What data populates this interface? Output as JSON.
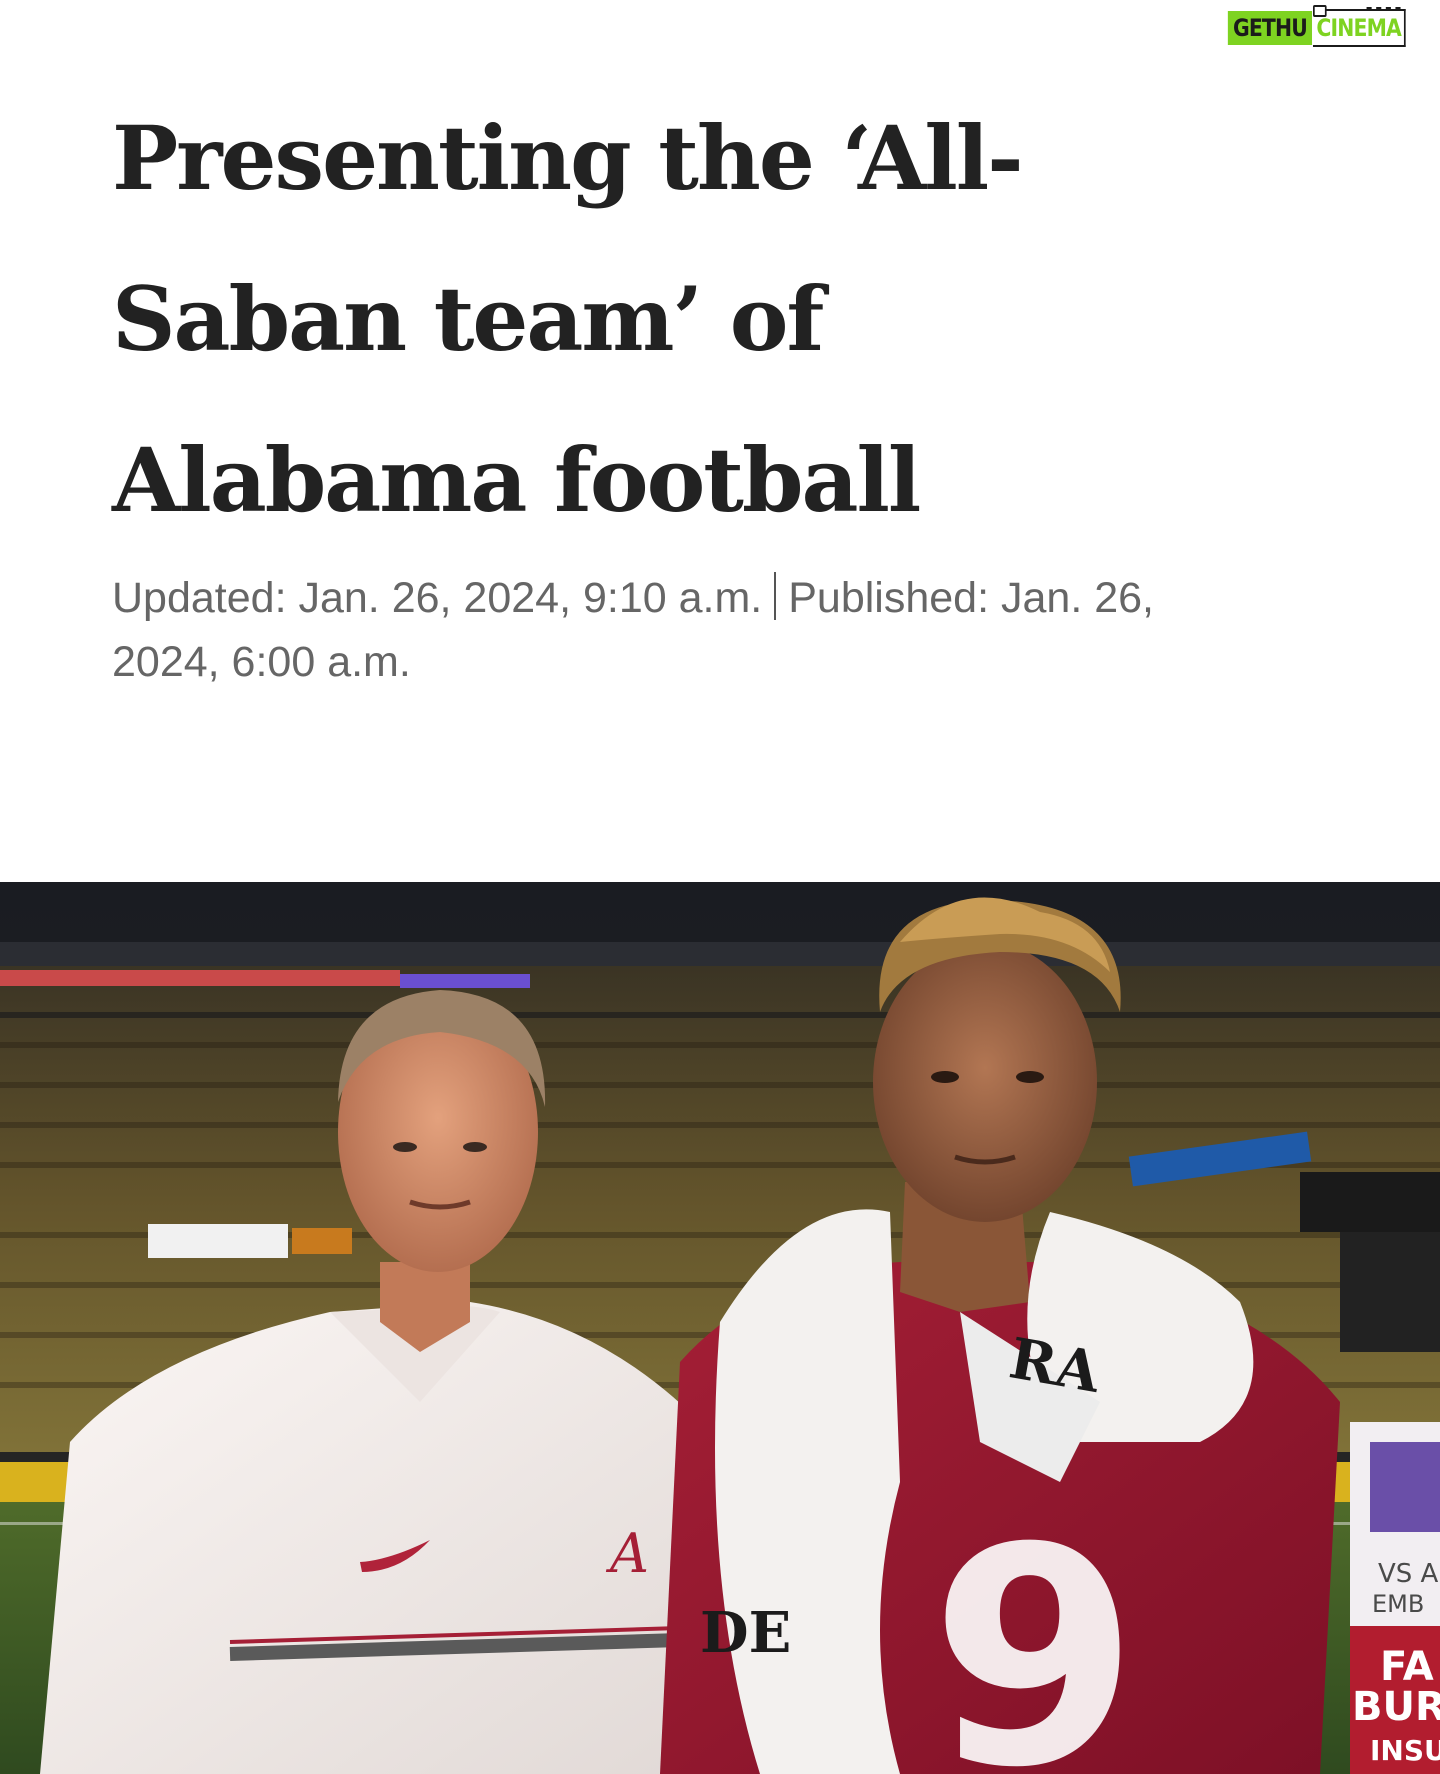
{
  "watermark": {
    "part1": "GETHU",
    "part2": "CINEMA"
  },
  "article": {
    "headline_lines": [
      "Presenting the ‘All-",
      "Saban team’ of",
      "Alabama football"
    ],
    "updated_label": "Updated: Jan. 26, 2024, 9:10 a.m.",
    "published_label": "Published: Jan. 26,",
    "published_continued": "2024, 6:00 a.m."
  },
  "hero_image": {
    "coach_shirt_logo": "A",
    "player_towel_text_1": "RA",
    "player_towel_text_2": "DE",
    "player_jersey_number": "9",
    "sideline_sign_1": "VS A",
    "sideline_sign_2": "EMB",
    "sideline_sign_3": "FA",
    "sideline_sign_4": "BURE",
    "sideline_sign_5": "INSU"
  }
}
